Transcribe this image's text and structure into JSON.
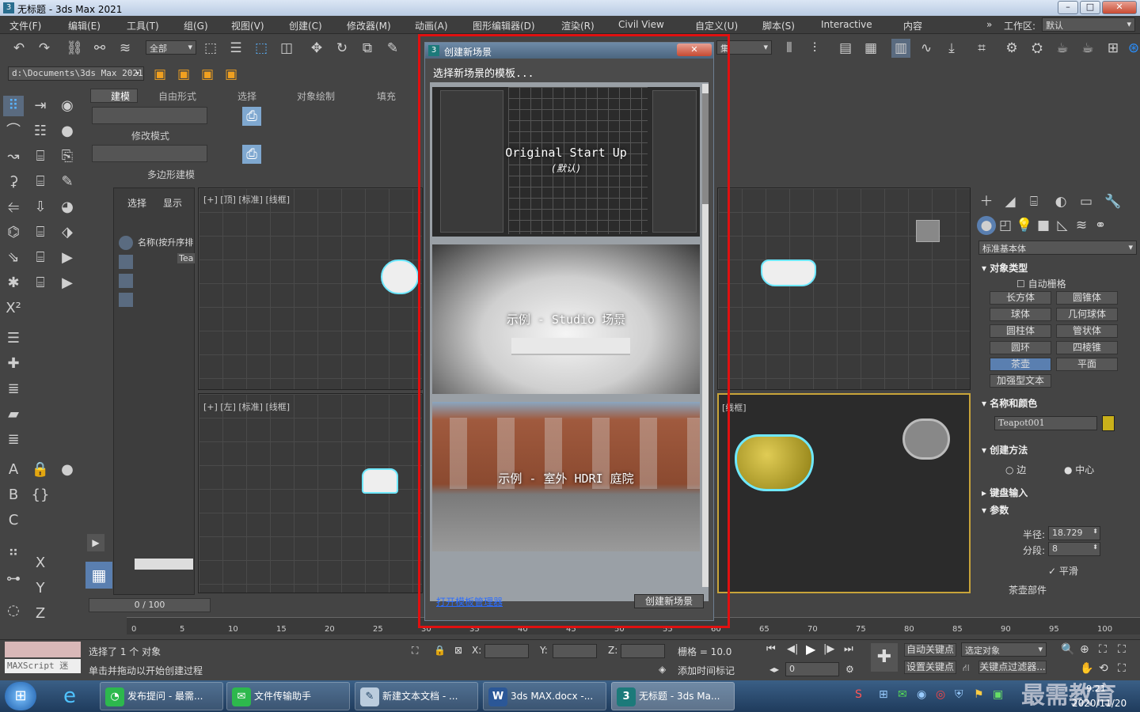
{
  "window": {
    "title": "无标题 - 3ds Max 2021",
    "app_icon": "3ds-max-icon"
  },
  "menu": [
    "文件(F)",
    "编辑(E)",
    "工具(T)",
    "组(G)",
    "视图(V)",
    "创建(C)",
    "修改器(M)",
    "动画(A)",
    "图形编辑器(D)",
    "渲染(R)",
    "Civil View",
    "自定义(U)",
    "脚本(S)",
    "Interactive",
    "内容"
  ],
  "workspace": {
    "label": "工作区:",
    "value": "默认"
  },
  "toolbar": {
    "selection_filter": "全部",
    "named_sel": "集"
  },
  "project_path": "d:\\Documents\\3ds Max 2021",
  "ribbon": {
    "tabs": [
      "建模",
      "自由形式",
      "选择",
      "对象绘制",
      "填充"
    ],
    "mode_label": "修改模式",
    "poly_label": "多边形建模"
  },
  "scene_explorer": {
    "tabs": [
      "选择",
      "显示"
    ],
    "column": "名称(按升序排",
    "item": "Tea"
  },
  "viewports": {
    "top": "[+] [顶] [标准] [线框]",
    "left": "[+] [左] [标准] [线框]",
    "persp": "[线框]"
  },
  "command_panel": {
    "category": "标准基本体",
    "object_type": "对象类型",
    "autogrid": "自动栅格",
    "buttons": [
      "长方体",
      "圆锥体",
      "球体",
      "几何球体",
      "圆柱体",
      "管状体",
      "圆环",
      "四棱锥",
      "茶壶",
      "平面"
    ],
    "extra_button": "加强型文本",
    "name_color": "名称和颜色",
    "object_name": "Teapot001",
    "object_color": "#c9b01a",
    "creation_method": "创建方法",
    "edge": "边",
    "center": "中心",
    "keyboard_entry": "键盘输入",
    "params": "参数",
    "radius_label": "半径:",
    "radius": "18.729",
    "segments_label": "分段:",
    "segments": "8",
    "smooth": "平滑",
    "teapot_parts": "茶壶部件"
  },
  "dialog": {
    "title": "创建新场景",
    "subtitle": "选择新场景的模板...",
    "templates": [
      {
        "name": "Original Start Up",
        "sub": "(默认)"
      },
      {
        "name": "示例 - Studio 场景",
        "sub": ""
      },
      {
        "name": "示例 - 室外 HDRI 庭院",
        "sub": ""
      }
    ],
    "manager_link": "打开模板管理器",
    "create_button": "创建新场景",
    "close": "✕"
  },
  "timeline": {
    "frame": "0 / 100",
    "ticks": [
      "0",
      "5",
      "10",
      "15",
      "20",
      "25",
      "30",
      "35",
      "40",
      "45",
      "50",
      "55",
      "60",
      "65",
      "70",
      "75",
      "80",
      "85",
      "90",
      "95",
      "100"
    ]
  },
  "status": {
    "maxscript": "MAXScript 迷",
    "selected": "选择了 1 个 对象",
    "hint": "单击并拖动以开始创建过程",
    "x": "X:",
    "y": "Y:",
    "z": "Z:",
    "grid": "栅格 = 10.0",
    "add_time_tag": "添加时间标记",
    "auto_key": "自动关键点",
    "set_key": "设置关键点",
    "sel_obj": "选定对象",
    "key_filter": "关键点过滤器...",
    "frame_value": "0"
  },
  "taskbar": {
    "tasks": [
      "发布提问 - 最需...",
      "文件传输助手",
      "新建文本文档 - ...",
      "3ds MAX.docx -...",
      "无标题 - 3ds Ma..."
    ],
    "time": "9:21",
    "date": "2020/11/20",
    "watermark": "最需教育"
  }
}
